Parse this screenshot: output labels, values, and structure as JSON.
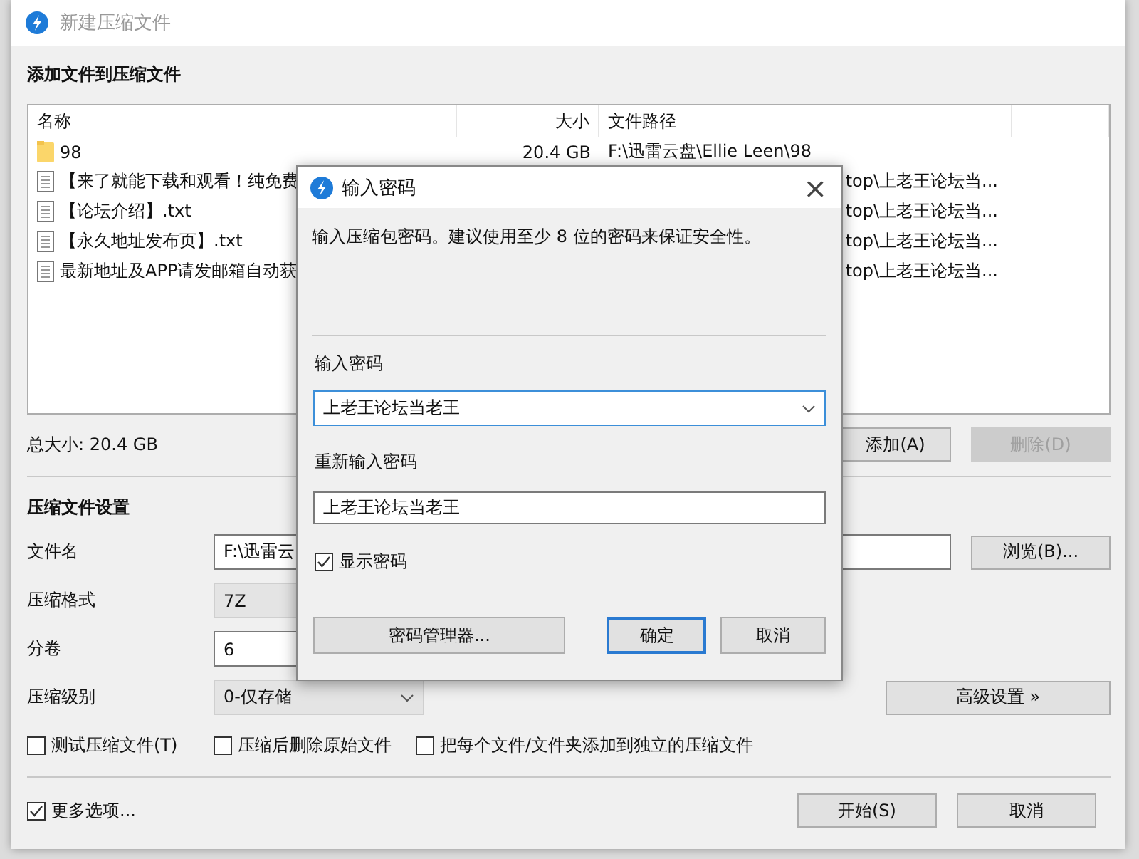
{
  "window": {
    "title": "新建压缩文件"
  },
  "add_section": {
    "heading": "添加文件到压缩文件",
    "columns": [
      "名称",
      "大小",
      "文件路径"
    ],
    "rows": [
      {
        "kind": "folder",
        "name": "98",
        "size": "20.4 GB",
        "path": "F:\\迅雷云盘\\Ellie Leen\\98"
      },
      {
        "kind": "file",
        "name": "【来了就能下载和观看！纯免费",
        "path": "top\\上老王论坛当..."
      },
      {
        "kind": "file",
        "name": "【论坛介绍】.txt",
        "path": "top\\上老王论坛当..."
      },
      {
        "kind": "file",
        "name": "【永久地址发布页】.txt",
        "path": "top\\上老王论坛当..."
      },
      {
        "kind": "file",
        "name": "最新地址及APP请发邮箱自动获",
        "path": "top\\上老王论坛当..."
      }
    ],
    "total": "总大小: 20.4 GB",
    "buttons": [
      {
        "label": "添加(A)",
        "disabled": false
      },
      {
        "label": "删除(D)",
        "disabled": true
      }
    ]
  },
  "settings": {
    "heading": "压缩文件设置",
    "fields": [
      {
        "kind": "text",
        "label": "文件名",
        "value": "F:\\迅雷云",
        "button": "浏览(B)..."
      },
      {
        "kind": "readonly",
        "label": "压缩格式",
        "value": "7Z"
      },
      {
        "kind": "text",
        "label": "分卷",
        "value": "6"
      },
      {
        "kind": "select",
        "label": "压缩级别",
        "value": "0-仅存储",
        "button": "高级设置 »"
      }
    ],
    "options": [
      {
        "label": "测试压缩文件(T)",
        "checked": false
      },
      {
        "label": "压缩后删除原始文件",
        "checked": false
      },
      {
        "label": "把每个文件/文件夹添加到独立的压缩文件",
        "checked": false
      }
    ],
    "more_options": {
      "label": "更多选项...",
      "checked": true
    },
    "buttons": [
      "开始(S)",
      "取消"
    ]
  },
  "dialog": {
    "title": "输入密码",
    "close": "×",
    "message": "输入压缩包密码。建议使用至少 8 位的密码来保证安全性。",
    "password_label": "输入密码",
    "password": "上老王论坛当老王",
    "confirm_label": "重新输入密码",
    "confirm": "上老王论坛当老王",
    "show_password": {
      "label": "显示密码",
      "checked": true
    },
    "buttons": [
      {
        "label": "密码管理器...",
        "default": false
      },
      {
        "label": "确定",
        "default": true
      },
      {
        "label": "取消",
        "default": false
      }
    ]
  }
}
